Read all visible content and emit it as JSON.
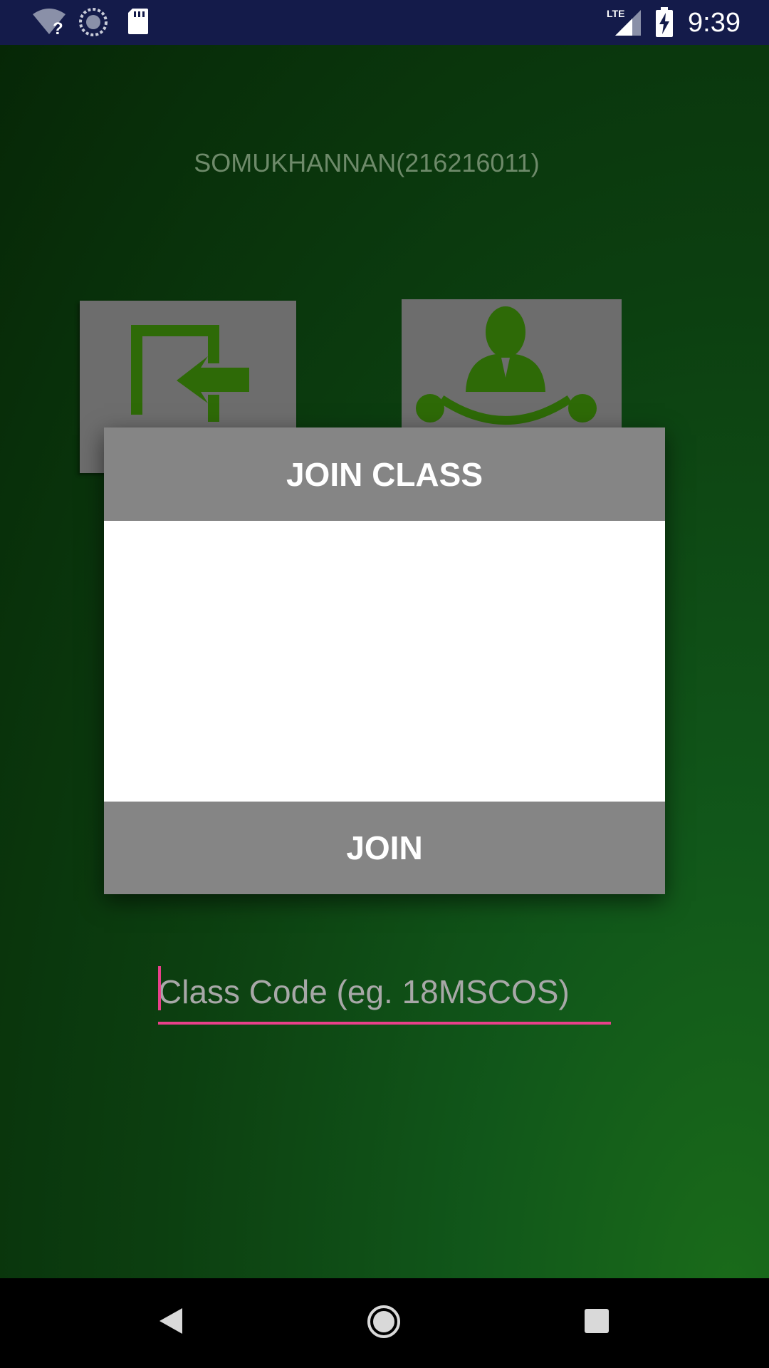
{
  "status_bar": {
    "time": "9:39",
    "icons": [
      "wifi-unknown-icon",
      "sync-icon",
      "sd-card-icon",
      "lte-signal-icon",
      "battery-charging-icon"
    ]
  },
  "background": {
    "user_name": "SOMUKHANNAN(216216011)",
    "tiles": [
      "join-class-icon",
      "class-person-icon"
    ]
  },
  "dialog": {
    "title": "JOIN CLASS",
    "input_placeholder": "Class Code (eg. 18MSCOS)",
    "input_value": "",
    "join_label": "JOIN"
  },
  "nav_bar": {
    "icons": [
      "back-icon",
      "home-icon",
      "recents-icon"
    ]
  },
  "colors": {
    "status_bar": "#141b4a",
    "dialog_header": "#858585",
    "accent": "#e9408a",
    "icon_green": "#2e6a07"
  }
}
